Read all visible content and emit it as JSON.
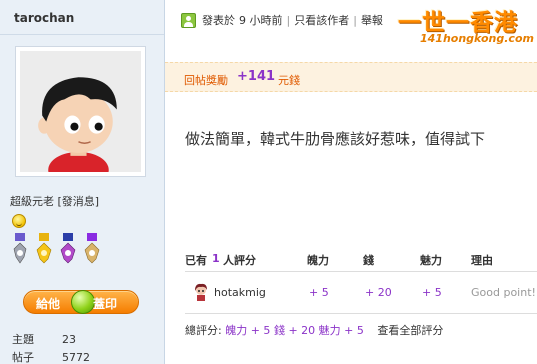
{
  "user": {
    "name": "tarochan",
    "rank": "超級元老",
    "pm_label": "[發消息]",
    "give_button": {
      "left": "給他",
      "right": "蓋印"
    },
    "stats": [
      {
        "label": "主題",
        "value": "23"
      },
      {
        "label": "帖子",
        "value": "5772"
      }
    ]
  },
  "post": {
    "posted_label": "發表於",
    "posted_time": "9 小時前",
    "only_author": "只看該作者",
    "report": "舉報",
    "reward": {
      "label": "回帖獎勵",
      "amount": "+141",
      "unit": "元錢"
    },
    "content": "做法簡單，韓式牛肋骨應該好惹味，值得試下"
  },
  "logo": {
    "main": "一世一香港",
    "sub": "141hongkong.com"
  },
  "rating": {
    "prefix": "已有",
    "count": "1",
    "suffix": "人評分",
    "columns": [
      "魄力",
      "錢",
      "魅力",
      "理由"
    ],
    "rows": [
      {
        "user": "hotakmig",
        "values": [
          "+ 5",
          "+ 20",
          "+ 5"
        ],
        "reason": "Good point!"
      }
    ],
    "total_label": "總評分:",
    "total": [
      {
        "name": "魄力",
        "value": "+ 5"
      },
      {
        "name": "錢",
        "value": "+ 20"
      },
      {
        "name": "魅力",
        "value": "+ 5"
      }
    ],
    "view_all": "查看全部評分"
  },
  "colors": {
    "accent": "#8b33c8",
    "reward": "#e05a00",
    "sidebar": "#e9f0f7",
    "logo": "#ff8a00"
  }
}
